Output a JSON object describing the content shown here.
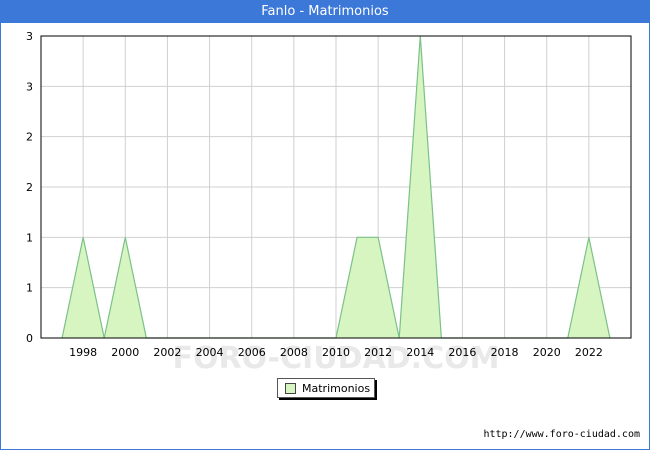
{
  "window": {
    "title": "Fanlo - Matrimonios"
  },
  "chart_data": {
    "type": "area",
    "title": "Fanlo - Matrimonios",
    "x": [
      1997,
      1998,
      1999,
      2000,
      2001,
      2002,
      2003,
      2004,
      2005,
      2006,
      2007,
      2008,
      2009,
      2010,
      2011,
      2012,
      2013,
      2014,
      2015,
      2016,
      2017,
      2018,
      2019,
      2020,
      2021,
      2022,
      2023
    ],
    "series": [
      {
        "name": "Matrimonios",
        "values": [
          0,
          1,
          0,
          1,
          0,
          0,
          0,
          0,
          0,
          0,
          0,
          0,
          0,
          0,
          1,
          1,
          0,
          3,
          0,
          0,
          0,
          0,
          0,
          0,
          0,
          1,
          0
        ]
      }
    ],
    "x_ticks": [
      "1998",
      "2000",
      "2002",
      "2004",
      "2006",
      "2008",
      "2010",
      "2012",
      "2014",
      "2016",
      "2018",
      "2020",
      "2022"
    ],
    "y_tick_labels": [
      "0",
      "1",
      "1",
      "2",
      "2",
      "3",
      "3"
    ],
    "ylim": [
      0,
      3
    ],
    "xlim": [
      1996,
      2024
    ],
    "grid": true,
    "legend_position": "bottom-center",
    "colors": {
      "fill": "#d6f5c0",
      "line": "#7cc08a",
      "grid": "#d0d0d0",
      "title_bar": "#3b78d8"
    }
  },
  "watermark": "FORO-CIUDAD.COM",
  "legend": {
    "label": "Matrimonios"
  },
  "source": "http://www.foro-ciudad.com"
}
